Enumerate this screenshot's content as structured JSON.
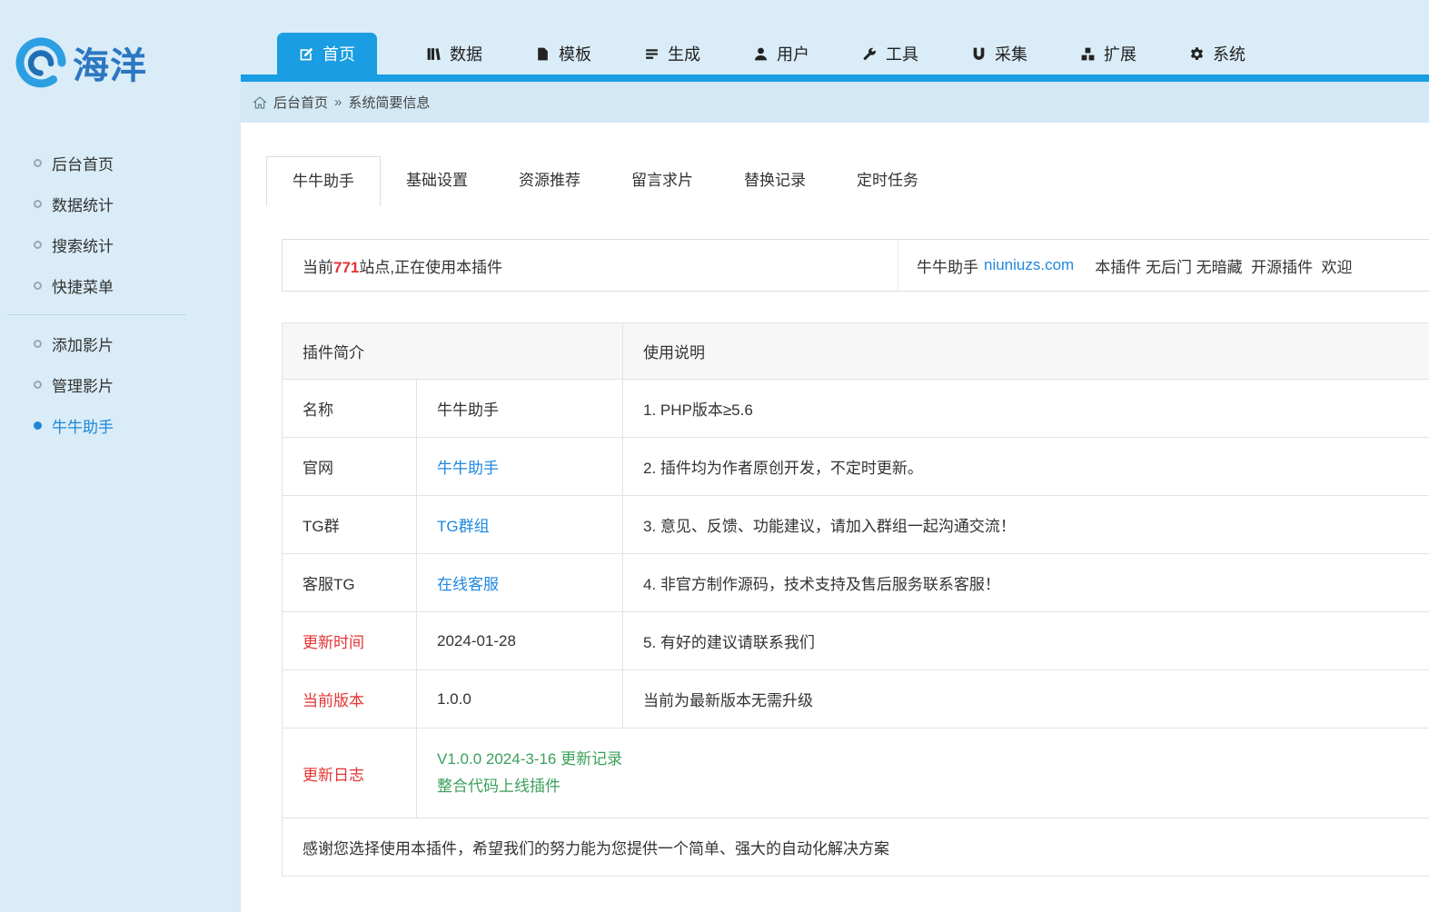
{
  "logo": {
    "title": "海洋"
  },
  "topnav": {
    "items": [
      {
        "label": "首页",
        "icon": "edit-icon"
      },
      {
        "label": "数据",
        "icon": "data-icon"
      },
      {
        "label": "模板",
        "icon": "template-icon"
      },
      {
        "label": "生成",
        "icon": "generate-icon"
      },
      {
        "label": "用户",
        "icon": "user-icon"
      },
      {
        "label": "工具",
        "icon": "tools-icon"
      },
      {
        "label": "采集",
        "icon": "collect-icon"
      },
      {
        "label": "扩展",
        "icon": "extend-icon"
      },
      {
        "label": "系统",
        "icon": "system-icon"
      }
    ],
    "active": "首页"
  },
  "breadcrumb": {
    "home": "后台首页",
    "separator": "»",
    "current": "系统简要信息"
  },
  "sidebar": {
    "group1": [
      "后台首页",
      "数据统计",
      "搜索统计",
      "快捷菜单"
    ],
    "group2": [
      "添加影片",
      "管理影片",
      "牛牛助手"
    ],
    "active": "牛牛助手"
  },
  "tabs": {
    "items": [
      "牛牛助手",
      "基础设置",
      "资源推荐",
      "留言求片",
      "替换记录",
      "定时任务"
    ],
    "active": "牛牛助手"
  },
  "infobar": {
    "left_prefix": "当前",
    "site_count": "771",
    "left_suffix": "站点,正在使用本插件",
    "right_title": "牛牛助手",
    "right_link": "niuniuzs.com",
    "right_text": "本插件 无后门 无暗藏  开源插件  欢迎"
  },
  "table": {
    "header_left": "插件简介",
    "header_right": "使用说明",
    "rows": [
      {
        "label": "名称",
        "value": "牛牛助手",
        "note": "1. PHP版本≥5.6"
      },
      {
        "label": "官网",
        "value": "牛牛助手",
        "note": "2. 插件均为作者原创开发，不定时更新。"
      },
      {
        "label": "TG群",
        "value": "TG群组",
        "note": "3. 意见、反馈、功能建议，请加入群组一起沟通交流！"
      },
      {
        "label": "客服TG",
        "value": "在线客服",
        "note": "4. 非官方制作源码，技术支持及售后服务联系客服！"
      },
      {
        "label": "更新时间",
        "value": "2024-01-28",
        "note": "5. 有好的建议请联系我们"
      },
      {
        "label": "当前版本",
        "value": "1.0.0",
        "note": "当前为最新版本无需升级"
      }
    ],
    "changelog": {
      "label": "更新日志",
      "lines": [
        "V1.0.0 2024-3-16 更新记录",
        "整合代码上线插件"
      ]
    },
    "footer": "感谢您选择使用本插件，希望我们的努力能为您提供一个简单、强大的自动化解决方案"
  },
  "colors": {
    "accent_blue": "#1a9de3",
    "link_blue": "#1d88e0",
    "alert_red": "#e53333",
    "success_green": "#3aa05a",
    "page_bg": "#d9ecf7"
  }
}
